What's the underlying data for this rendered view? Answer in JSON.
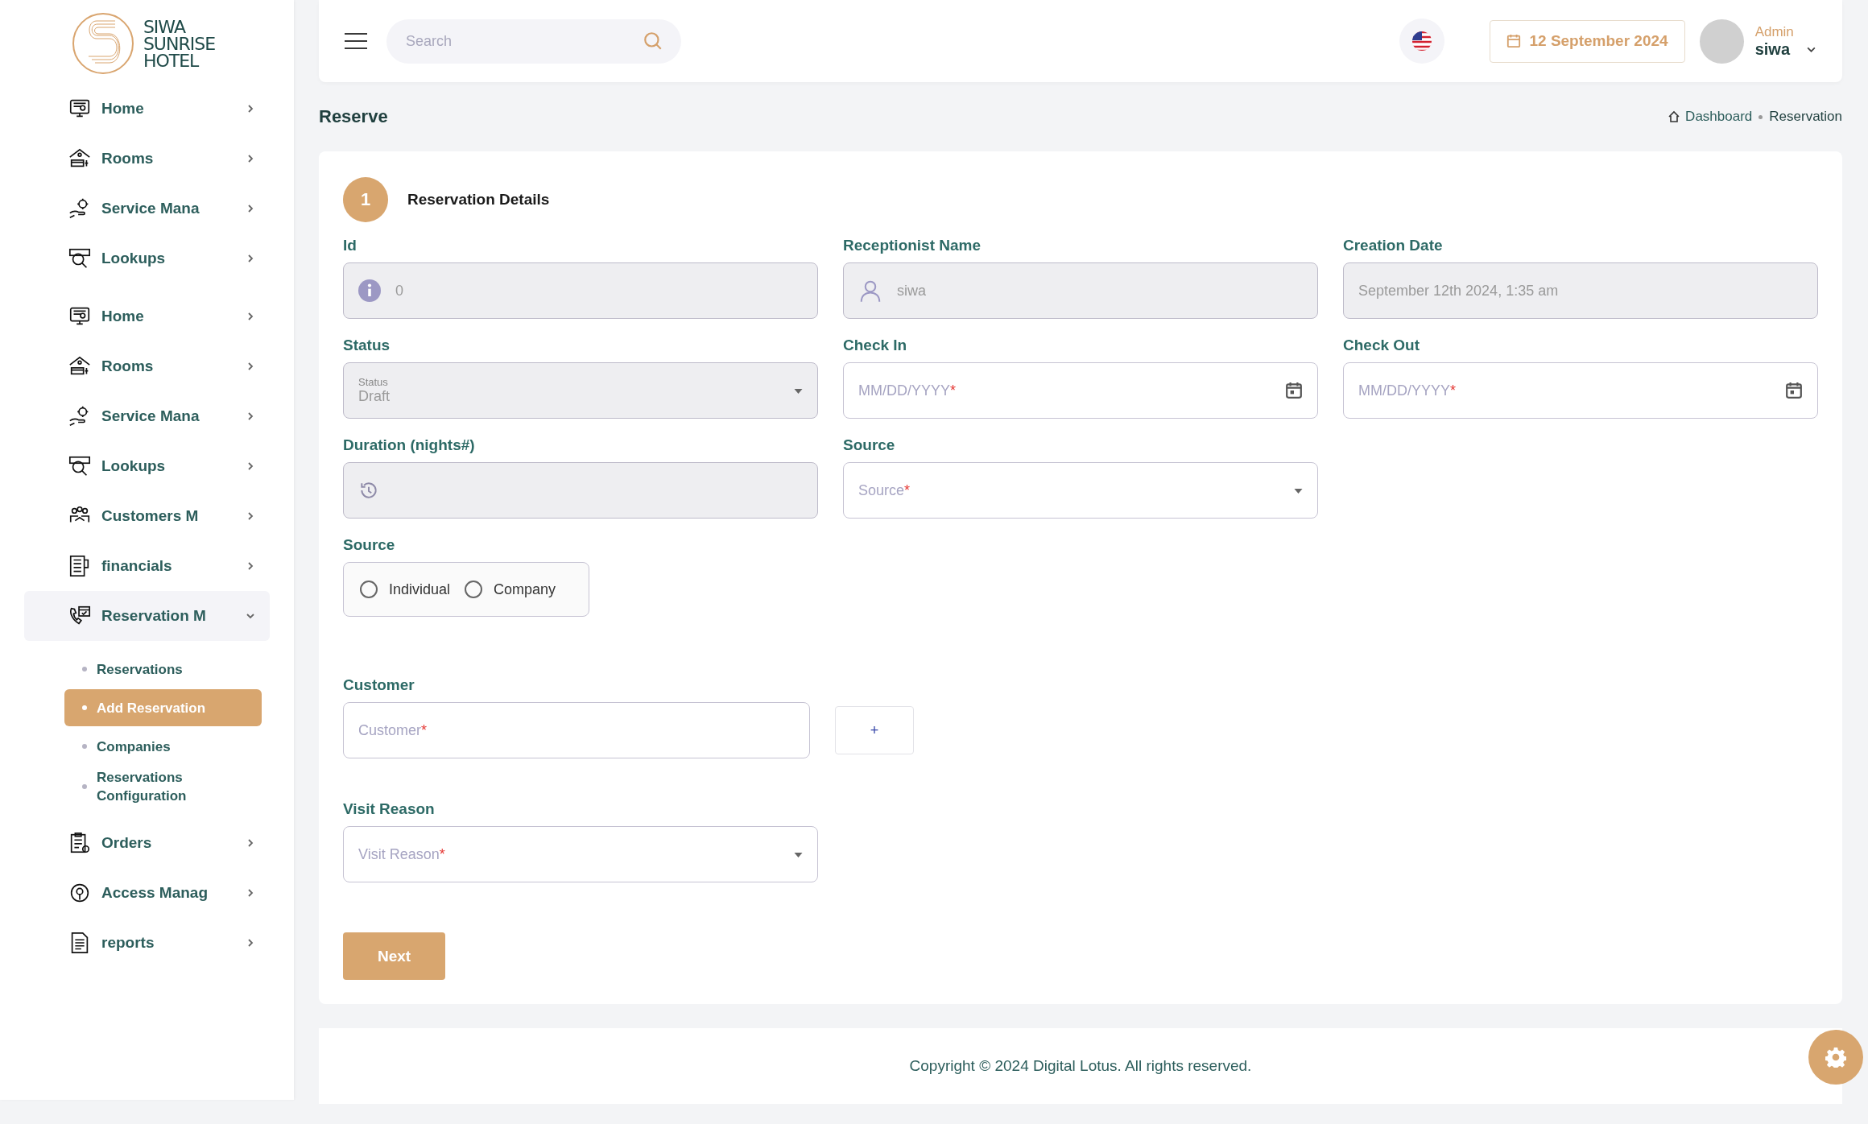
{
  "brand": {
    "lines": [
      "SIWA",
      "SUNRISE",
      "HOTEL"
    ]
  },
  "sidebar": {
    "groups": [
      [
        {
          "kind": "home",
          "label": "Home",
          "expanded": false
        },
        {
          "kind": "rooms",
          "label": "Rooms",
          "expanded": false
        },
        {
          "kind": "service",
          "label": "Service Mana",
          "expanded": false
        },
        {
          "kind": "lookups",
          "label": "Lookups",
          "expanded": false
        }
      ],
      [
        {
          "kind": "home",
          "label": "Home",
          "expanded": false
        },
        {
          "kind": "rooms",
          "label": "Rooms",
          "expanded": false
        },
        {
          "kind": "service",
          "label": "Service Mana",
          "expanded": false
        },
        {
          "kind": "lookups",
          "label": "Lookups",
          "expanded": false
        },
        {
          "kind": "customers",
          "label": "Customers M",
          "expanded": false
        },
        {
          "kind": "financials",
          "label": "financials",
          "expanded": false
        },
        {
          "kind": "reservation",
          "label": "Reservation M",
          "expanded": true,
          "children": [
            {
              "label": "Reservations",
              "selected": false
            },
            {
              "label": "Add Reservation",
              "selected": true
            },
            {
              "label": "Companies",
              "selected": false
            },
            {
              "label": "Reservations Configuration",
              "selected": false
            }
          ]
        },
        {
          "kind": "orders",
          "label": "Orders",
          "expanded": false
        },
        {
          "kind": "access",
          "label": "Access Manag",
          "expanded": false
        },
        {
          "kind": "reports",
          "label": "reports",
          "expanded": false
        }
      ]
    ]
  },
  "header": {
    "search": {
      "placeholder": "Search"
    },
    "date": "12 September 2024",
    "user": {
      "role": "Admin",
      "name": "siwa"
    }
  },
  "page": {
    "title": "Reserve",
    "breadcrumb": [
      "Dashboard",
      "Reservation"
    ]
  },
  "form": {
    "step": {
      "number": "1",
      "title": "Reservation Details"
    },
    "rows": [
      [
        {
          "kind": "id",
          "label": "Id",
          "value": "0",
          "disabled": true
        },
        {
          "kind": "user",
          "label": "Receptionist Name",
          "value": "siwa",
          "disabled": true
        },
        {
          "kind": "text",
          "label": "Creation Date",
          "value": "September 12th 2024, 1:35 am",
          "disabled": true
        }
      ],
      [
        {
          "kind": "select",
          "label": "Status",
          "floating_label": "Status",
          "value": "Draft",
          "disabled": true
        },
        {
          "kind": "date",
          "label": "Check In",
          "placeholder": "MM/DD/YYYY",
          "required_mark": "*",
          "disabled": false
        },
        {
          "kind": "date",
          "label": "Check Out",
          "placeholder": "MM/DD/YYYY",
          "required_mark": "*",
          "disabled": false
        }
      ],
      [
        {
          "kind": "duration",
          "label": "Duration (nights#)",
          "disabled": true
        },
        {
          "kind": "select",
          "label": "Source",
          "placeholder": "Source",
          "required_mark": "*",
          "disabled": false
        }
      ],
      [
        {
          "kind": "radio",
          "label": "Source",
          "options": [
            {
              "label": "Individual",
              "selected": false
            },
            {
              "label": "Company",
              "selected": false
            }
          ]
        }
      ],
      [
        {
          "kind": "lookup",
          "label": "Customer",
          "placeholder": "Customer",
          "required_mark": "*",
          "button": "+",
          "disabled": false
        }
      ],
      [
        {
          "kind": "select",
          "label": "Visit Reason",
          "placeholder": "Visit Reason",
          "required_mark": "*",
          "disabled": false
        }
      ]
    ],
    "submit": "Next"
  },
  "footer": {
    "text": "Copyright © 2024 Digital Lotus. All rights reserved."
  }
}
